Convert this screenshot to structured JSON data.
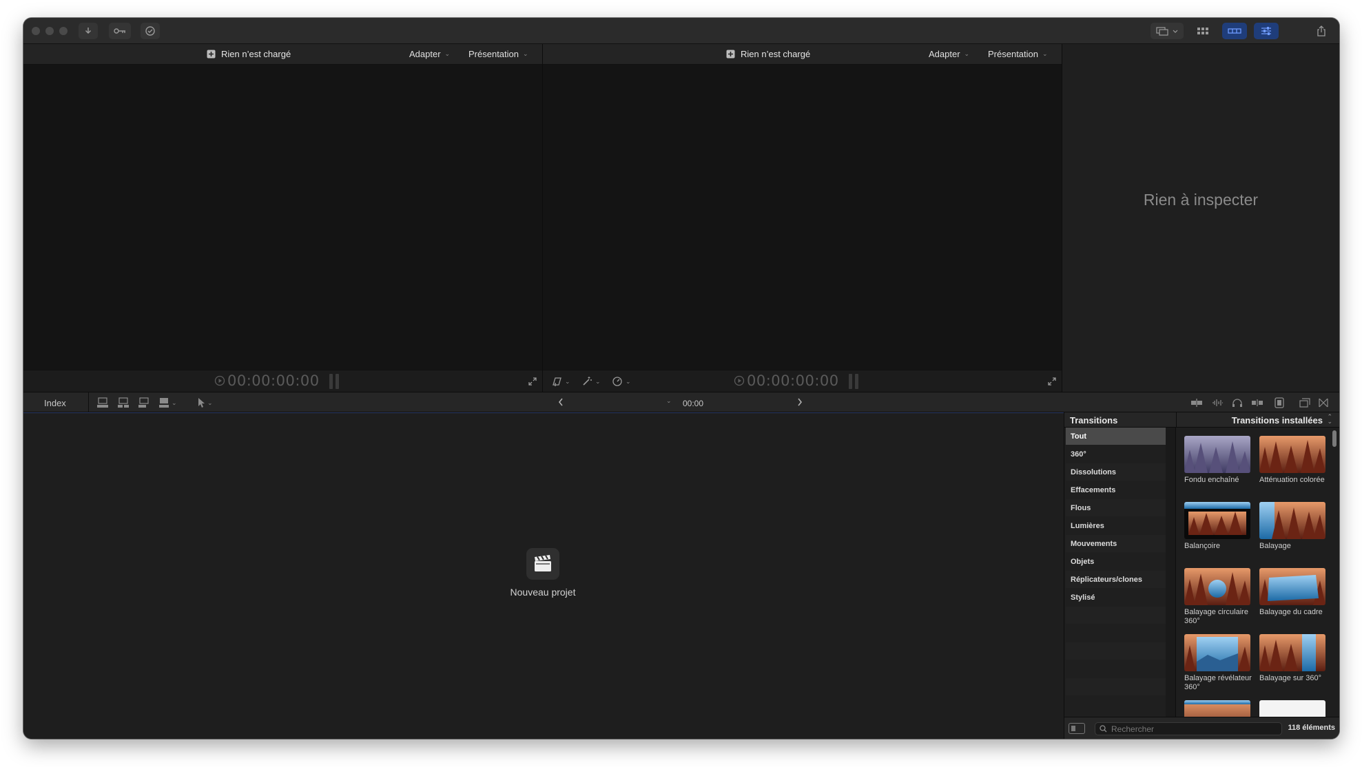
{
  "viewers": [
    {
      "title": "Rien n’est chargé",
      "fit_label": "Adapter",
      "view_label": "Présentation",
      "timecode": "00:00:00:00"
    },
    {
      "title": "Rien n’est chargé",
      "fit_label": "Adapter",
      "view_label": "Présentation",
      "timecode": "00:00:00:00"
    }
  ],
  "inspector": {
    "empty_text": "Rien à inspecter"
  },
  "timeline": {
    "index_label": "Index",
    "timecode": "00:00",
    "new_project_label": "Nouveau projet"
  },
  "browser": {
    "title": "Transitions",
    "filter_label": "Transitions installées",
    "categories": [
      "Tout",
      "360°",
      "Dissolutions",
      "Effacements",
      "Flous",
      "Lumières",
      "Mouvements",
      "Objets",
      "Réplicateurs/clones",
      "Stylisé"
    ],
    "selected_category": "Tout",
    "items": [
      {
        "label": "Fondu enchaîné"
      },
      {
        "label": "Atténuation colorée"
      },
      {
        "label": "Balançoire"
      },
      {
        "label": "Balayage"
      },
      {
        "label": "Balayage circulaire 360°"
      },
      {
        "label": "Balayage du cadre"
      },
      {
        "label": "Balayage révélateur 360°"
      },
      {
        "label": "Balayage sur 360°"
      }
    ],
    "search_placeholder": "Rechercher",
    "count_label": "118 éléments"
  },
  "colors": {
    "accent": "#1f3d7a",
    "accent_icon": "#6f9bff",
    "background": "#1e1e1e",
    "viewer": "#141414"
  }
}
